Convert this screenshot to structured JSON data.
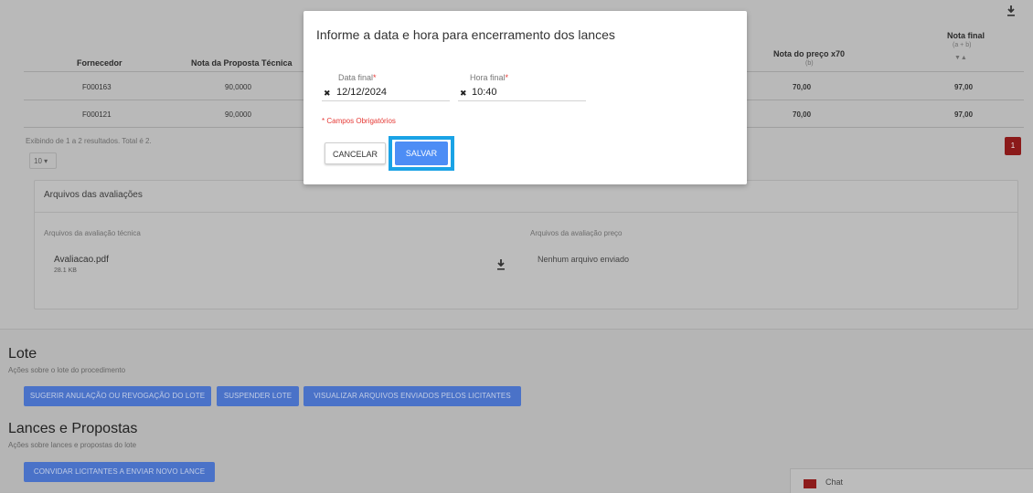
{
  "table": {
    "headers": [
      {
        "label": "Fornecedor"
      },
      {
        "label": "Nota da Proposta Técnica"
      },
      {
        "label": "Nota do preço x70",
        "sub": "(b)"
      },
      {
        "label": "Nota final",
        "sub": "(a + b)",
        "sort": "▼▲"
      }
    ],
    "rows": [
      {
        "fornecedor": "F000163",
        "nota_tecnica": "90,0000",
        "nota_preco": "70,00",
        "nota_final": "97,00"
      },
      {
        "fornecedor": "F000121",
        "nota_tecnica": "90,0000",
        "nota_preco": "70,00",
        "nota_final": "97,00"
      }
    ],
    "results_text": "Exibindo de 1 a 2 resultados. Total é 2.",
    "page_size": "10 ▾",
    "current_page": "1"
  },
  "files_card": {
    "title": "Arquivos das avaliações",
    "tech_label": "Arquivos da avaliação técnica",
    "price_label": "Arquivos da avaliação preço",
    "file_name": "Avaliacao.pdf",
    "file_size": "28.1 KB",
    "no_file": "Nenhum arquivo enviado"
  },
  "lote": {
    "title": "Lote",
    "subtitle": "Ações sobre o lote do procedimento",
    "buttons": [
      "SUGERIR ANULAÇÃO OU REVOGAÇÃO DO LOTE",
      "SUSPENDER LOTE",
      "VISUALIZAR ARQUIVOS ENVIADOS PELOS LICITANTES"
    ]
  },
  "lances": {
    "title": "Lances e Propostas",
    "subtitle": "Ações sobre lances e propostas do lote",
    "button": "CONVIDAR LICITANTES A ENVIAR NOVO LANCE"
  },
  "chat": {
    "label": "Chat"
  },
  "modal": {
    "title": "Informe a data e hora para encerramento dos lances",
    "date_label": "Data final",
    "date_value": "12/12/2024",
    "time_label": "Hora final",
    "time_value": "10:40",
    "required_mark": "*",
    "clear_icon": "✖",
    "required_note": "* Campos Obrigatórios",
    "cancel_label": "CANCELAR",
    "save_label": "SALVAR"
  },
  "colors": {
    "accent": "#4d8df5",
    "highlight": "#1aa3e6",
    "required": "#e53935",
    "action_button": "#4a72c8",
    "page_badge": "#8b1a1a"
  }
}
